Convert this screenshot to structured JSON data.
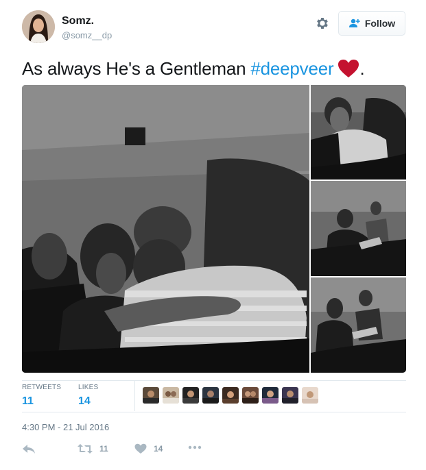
{
  "user": {
    "name": "Somz.",
    "handle": "@somz__dp"
  },
  "header": {
    "follow_label": "Follow",
    "gear_icon": "gear-icon",
    "follow_icon": "add-user-icon"
  },
  "tweet": {
    "text_before": "As always He's a Gentleman ",
    "hashtag": "#deepveer",
    "emoji": "red-heart",
    "text_after": "."
  },
  "media": {
    "photo_count": 4
  },
  "stats": {
    "retweets_label": "RETWEETS",
    "retweets_value": "11",
    "likes_label": "LIKES",
    "likes_value": "14",
    "liker_avatar_count": 9
  },
  "timestamp": "4:30 PM - 21 Jul 2016",
  "actions": {
    "reply_icon": "reply-icon",
    "retweet_icon": "retweet-icon",
    "retweet_count": "11",
    "like_icon": "heart-icon",
    "like_count": "14",
    "more_icon": "more-icon"
  },
  "colors": {
    "link_blue": "#1b95e0",
    "muted": "#657786",
    "heart_red": "#c4122f",
    "border": "#e1e8ed"
  }
}
